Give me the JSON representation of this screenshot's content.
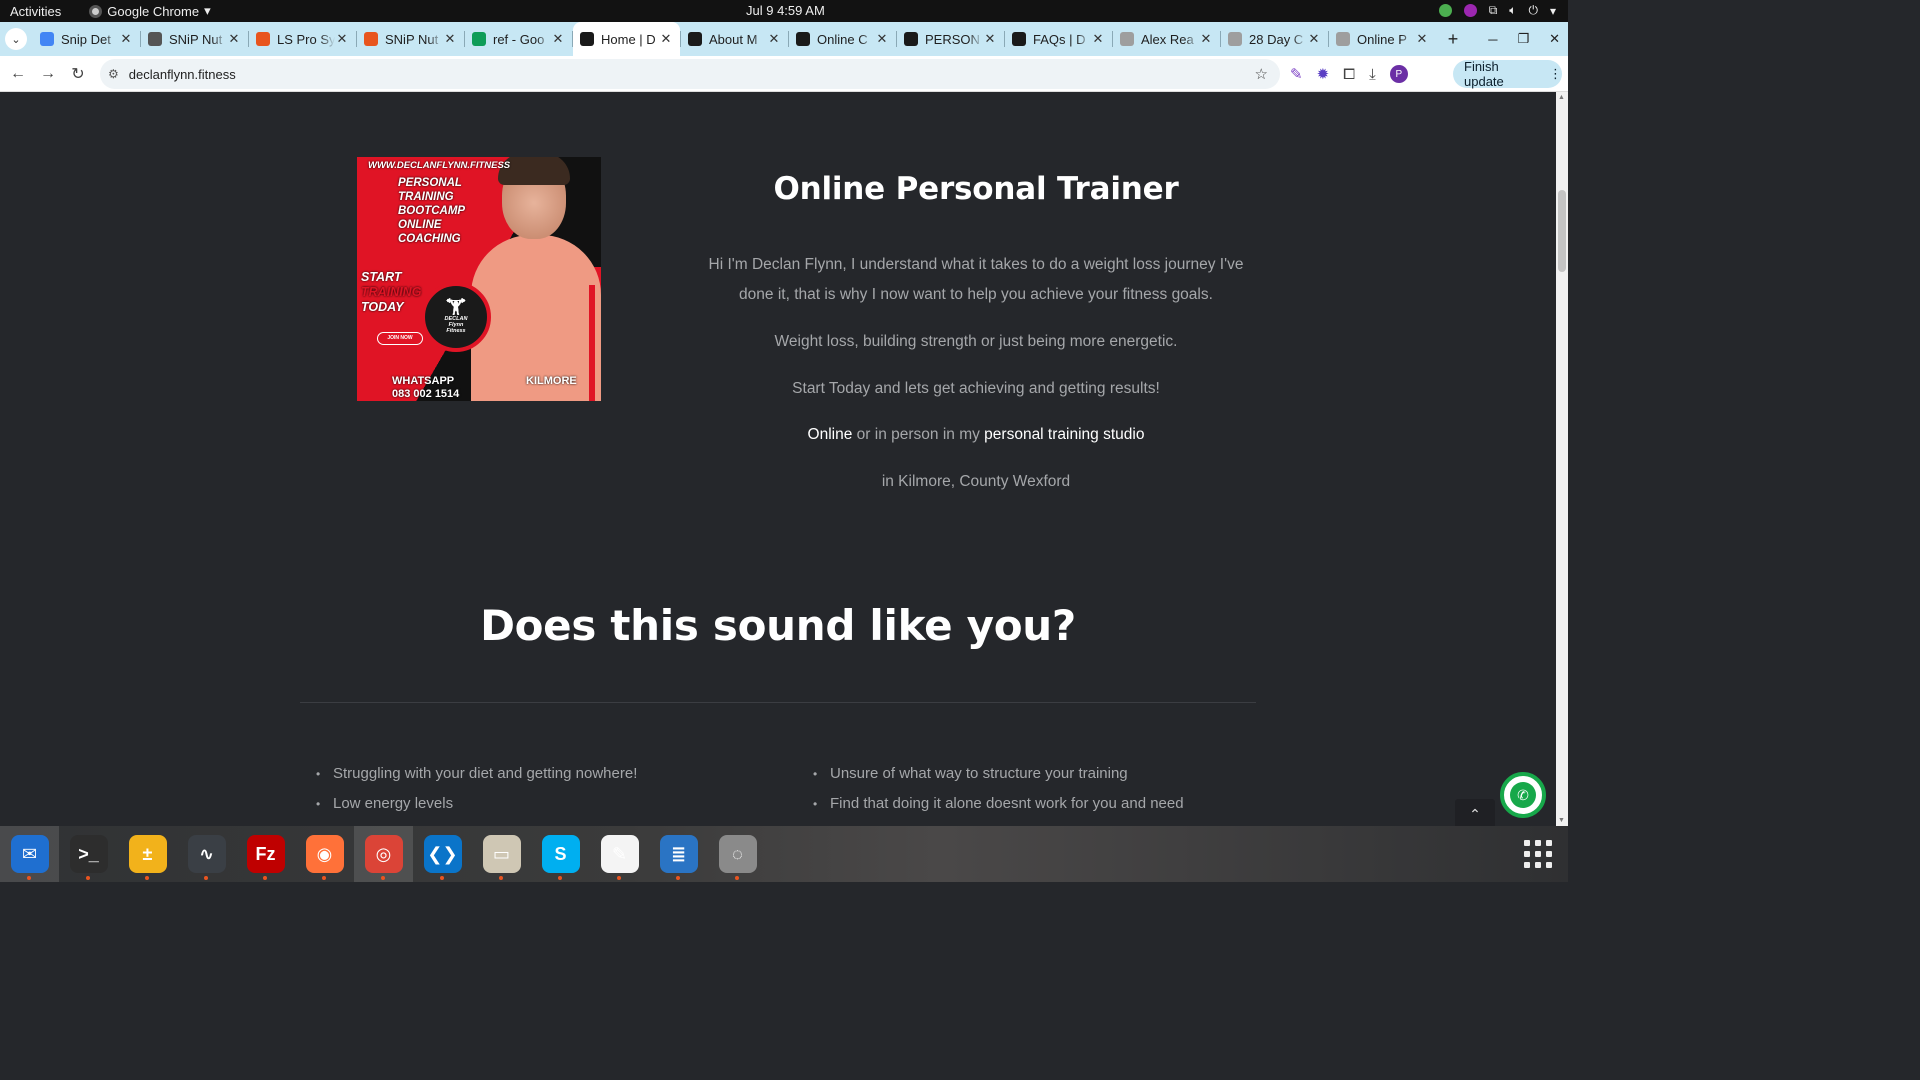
{
  "topbar": {
    "activities": "Activities",
    "app_name": "Google Chrome",
    "clock": "Jul 9  4:59 AM"
  },
  "tabs": [
    {
      "label": "Snip Det",
      "favicon": "docs-icon",
      "color": "#4285f4"
    },
    {
      "label": "SNiP Nut",
      "favicon": "snip-icon",
      "color": "#555555"
    },
    {
      "label": "LS Pro Sy",
      "favicon": "ls-icon",
      "color": "#e8551e"
    },
    {
      "label": "SNiP Nut",
      "favicon": "snip2-icon",
      "color": "#e8551e"
    },
    {
      "label": "ref - Goo",
      "favicon": "sheets-icon",
      "color": "#0f9d58"
    },
    {
      "label": "Home | D",
      "favicon": "df-icon",
      "color": "#1a1a1a",
      "active": true
    },
    {
      "label": "About M",
      "favicon": "df-icon",
      "color": "#1a1a1a"
    },
    {
      "label": "Online C",
      "favicon": "df-icon",
      "color": "#1a1a1a"
    },
    {
      "label": "PERSON",
      "favicon": "df-icon",
      "color": "#1a1a1a"
    },
    {
      "label": "FAQs | D",
      "favicon": "df-icon",
      "color": "#1a1a1a"
    },
    {
      "label": "Alex Rea",
      "favicon": "page-icon",
      "color": "#9e9e9e"
    },
    {
      "label": "28 Day C",
      "favicon": "page-icon",
      "color": "#9e9e9e"
    },
    {
      "label": "Online P",
      "favicon": "page-icon",
      "color": "#9e9e9e"
    }
  ],
  "toolbar": {
    "url": "declanflynn.fitness",
    "finish_update": "Finish update",
    "profile_initial": "P"
  },
  "promo": {
    "url": "WWW.DECLANFLYNN.FITNESS",
    "services": [
      "PERSONAL",
      "TRAINING",
      "BOOTCAMP",
      "ONLINE",
      "COACHING"
    ],
    "start_line1": "START",
    "start_line2": "TRAINING",
    "start_line3": "TODAY",
    "join": "JOIN NOW",
    "logo_line1": "DECLAN",
    "logo_line2": "Flynn",
    "logo_line3": "Fitness",
    "whatsapp_label": "WHATSAPP",
    "whatsapp_number": "083 002 1514",
    "location": "KILMORE"
  },
  "intro": {
    "title": "Online Personal Trainer",
    "p1": "Hi I'm Declan Flynn, I understand what it takes to do a weight loss journey I've done it, that is why I now want to help you achieve your fitness goals.",
    "p2": "Weight loss, building strength or just being more energetic.",
    "p3": "Start Today and lets get achieving and getting results!",
    "p4_link1": "Online",
    "p4_mid": " or in person in my ",
    "p4_link2": "personal training studio",
    "p5": "in Kilmore, County Wexford"
  },
  "section": {
    "title": "Does this sound like you?",
    "left_bullets": [
      "Struggling with your diet and getting nowhere!",
      "Low energy levels"
    ],
    "right_bullets": [
      "Unsure of what way to structure your training",
      "Find that doing it alone doesnt work for you and need"
    ]
  },
  "dock": [
    {
      "name": "thunderbird-icon",
      "color": "#1f6fd0",
      "glyph": "✉",
      "active": true
    },
    {
      "name": "terminal-icon",
      "color": "#2d2d2d",
      "glyph": ">_"
    },
    {
      "name": "calculator-icon",
      "color": "#f2b21b",
      "glyph": "±"
    },
    {
      "name": "system-monitor-icon",
      "color": "#3a3f45",
      "glyph": "∿"
    },
    {
      "name": "filezilla-icon",
      "color": "#bf0000",
      "glyph": "Fz"
    },
    {
      "name": "firefox-icon",
      "color": "#ff7139",
      "glyph": "◉"
    },
    {
      "name": "chrome-icon",
      "color": "#db4437",
      "glyph": "◎",
      "active": true
    },
    {
      "name": "vscode-icon",
      "color": "#0a74c9",
      "glyph": "❮❯"
    },
    {
      "name": "files-icon",
      "color": "#cfc7b4",
      "glyph": "▭"
    },
    {
      "name": "skype-icon",
      "color": "#00aff0",
      "glyph": "S"
    },
    {
      "name": "text-editor-icon",
      "color": "#f4f4f4",
      "glyph": "✎"
    },
    {
      "name": "libreoffice-writer-icon",
      "color": "#2a74c4",
      "glyph": "≣"
    },
    {
      "name": "disk-utility-icon",
      "color": "#8a8a8a",
      "glyph": "◌"
    }
  ]
}
